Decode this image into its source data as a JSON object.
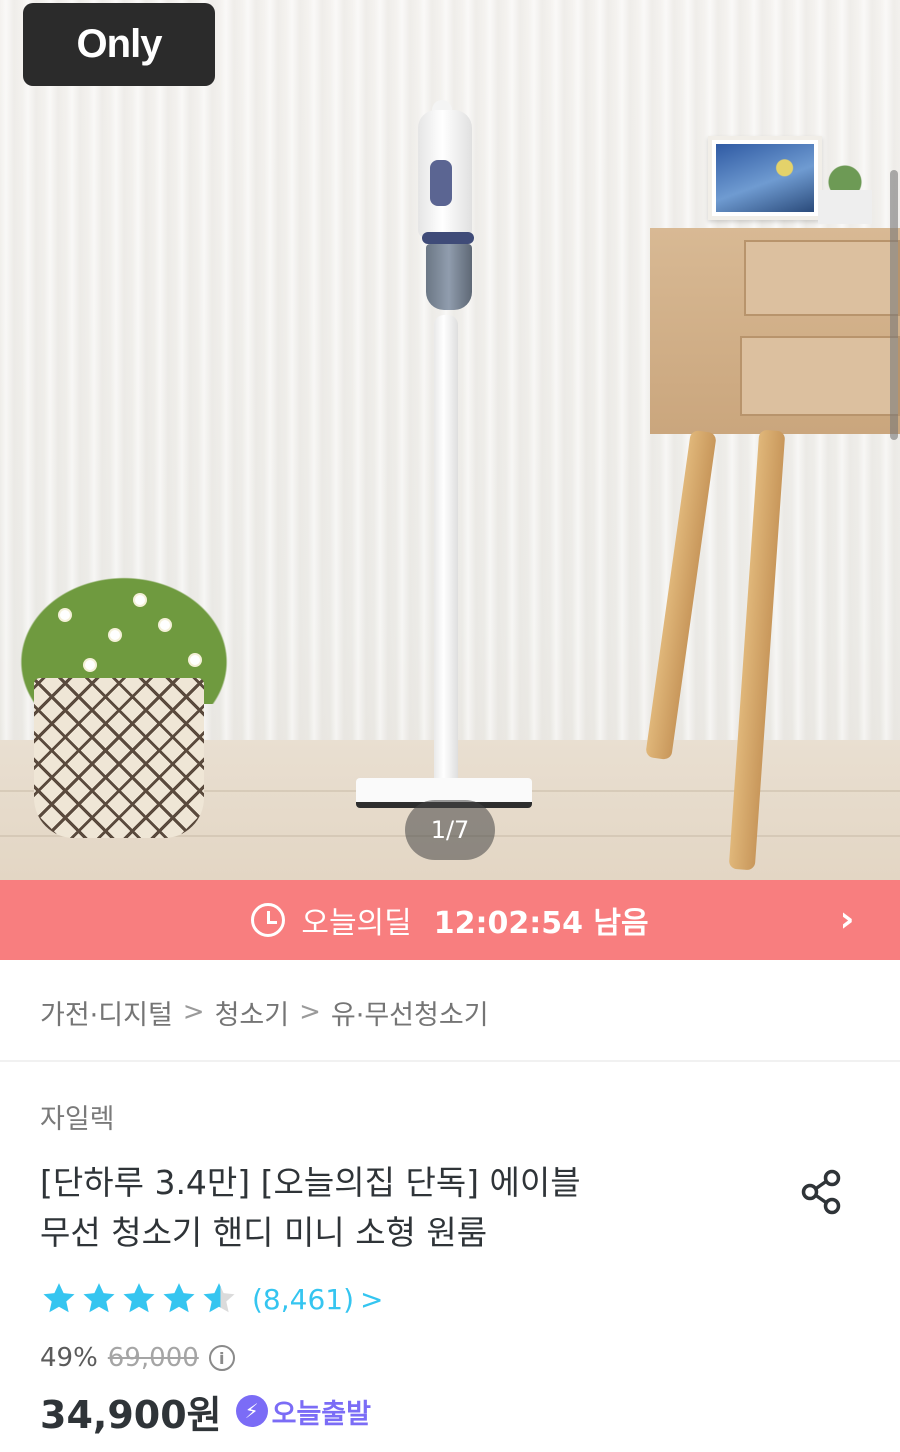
{
  "hero": {
    "badge": "Only",
    "pager": "1/7"
  },
  "deal_bar": {
    "label": "오늘의딜",
    "time_left": "12:02:54 남음"
  },
  "breadcrumb": {
    "items": [
      "가전·디지털",
      "청소기",
      "유·무선청소기"
    ]
  },
  "product": {
    "brand": "자일렉",
    "title_line1": "[단하루 3.4만] [오늘의집 단독] 에이블",
    "title_line2": "무선 청소기 핸디 미니 소형 원룸",
    "rating": 4.5,
    "review_count": "(8,461)",
    "discount": "49%",
    "original_price": "69,000",
    "final_price": "34,900원",
    "delivery_badge": "오늘출발"
  },
  "colors": {
    "deal_bar": "#f87e7f",
    "star": "#35c5f0",
    "delivery": "#7b6cf6"
  }
}
